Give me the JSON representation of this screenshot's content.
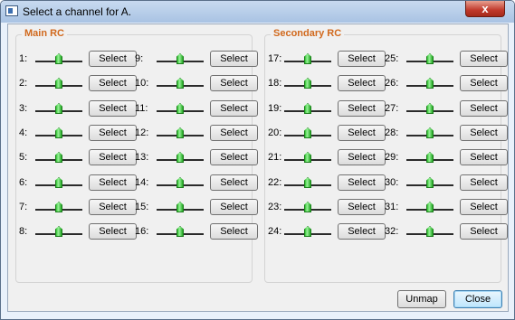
{
  "window": {
    "title": "Select a channel for A.",
    "close_glyph": "x"
  },
  "groups": {
    "main": {
      "label": "Main RC"
    },
    "secondary": {
      "label": "Secondary RC"
    }
  },
  "select_label": "Select",
  "channels": [
    {
      "num": "1:"
    },
    {
      "num": "2:"
    },
    {
      "num": "3:"
    },
    {
      "num": "4:"
    },
    {
      "num": "5:"
    },
    {
      "num": "6:"
    },
    {
      "num": "7:"
    },
    {
      "num": "8:"
    },
    {
      "num": "9:"
    },
    {
      "num": "10:"
    },
    {
      "num": "11:"
    },
    {
      "num": "12:"
    },
    {
      "num": "13:"
    },
    {
      "num": "14:"
    },
    {
      "num": "15:"
    },
    {
      "num": "16:"
    },
    {
      "num": "17:"
    },
    {
      "num": "18:"
    },
    {
      "num": "19:"
    },
    {
      "num": "20:"
    },
    {
      "num": "21:"
    },
    {
      "num": "22:"
    },
    {
      "num": "23:"
    },
    {
      "num": "24:"
    },
    {
      "num": "25:"
    },
    {
      "num": "26:"
    },
    {
      "num": "27:"
    },
    {
      "num": "28:"
    },
    {
      "num": "29:"
    },
    {
      "num": "30:"
    },
    {
      "num": "31:"
    },
    {
      "num": "32:"
    }
  ],
  "footer": {
    "unmap_label": "Unmap",
    "close_label": "Close"
  },
  "colors": {
    "group_label": "#d1691d",
    "slider_thumb": "#2fc42f"
  }
}
